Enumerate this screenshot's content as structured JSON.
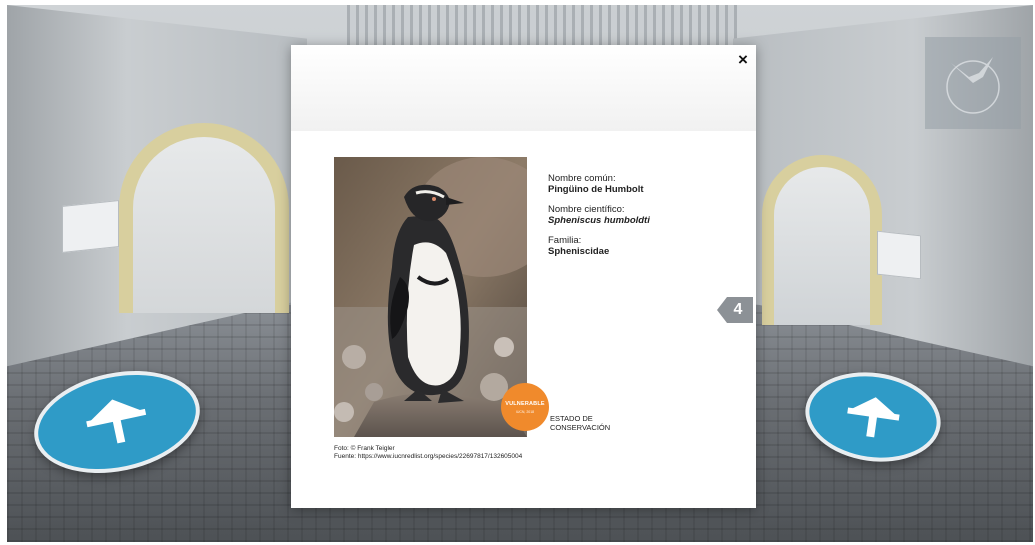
{
  "modal": {
    "close_label": "×",
    "image_alt": "Pingüino de Humbolt",
    "common_name_label": "Nombre común:",
    "common_name_value": "Pingüino de Humbolt",
    "scientific_name_label": "Nombre científico:",
    "scientific_name_value": "Spheniscus humboldti",
    "family_label": "Familia:",
    "family_value": "Spheniscidae",
    "status_badge_title": "VULNERABLE",
    "status_badge_sub": "IUCN, 2018",
    "status_label_line1": "ESTADO DE",
    "status_label_line2": "CONSERVACIÓN",
    "photo_credit": "Foto: © Frank Teigler",
    "source_credit": "Fuente: https://www.iucnredlist.org/species/22697817/132605004"
  },
  "navigation": {
    "page_number": "4"
  },
  "colors": {
    "hotspot": "#2f9bc7",
    "badge": "#f08a2c",
    "page_indicator": "#8c9196"
  }
}
